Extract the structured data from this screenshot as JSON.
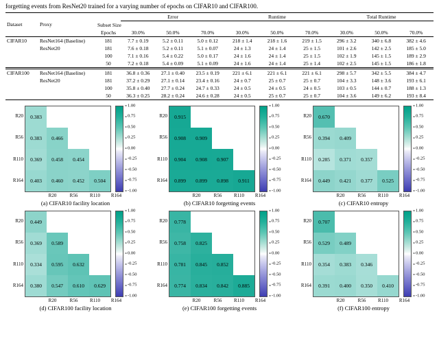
{
  "caption_top": "forgetting events from ResNet20 trained for a varying number of epochs on CIFAR10 and CIFAR100.",
  "table": {
    "col_groups": [
      {
        "title": "Error",
        "sizes": [
          "30.0%",
          "50.0%",
          "70.0%"
        ]
      },
      {
        "title": "Runtime",
        "sizes": [
          "30.0%",
          "50.0%",
          "70.0%"
        ]
      },
      {
        "title": "Total Runtime",
        "sizes": [
          "30.0%",
          "50.0%",
          "70.0%"
        ]
      }
    ],
    "head_left": {
      "dataset": "Dataset",
      "proxy": "Proxy",
      "epochs": "Epochs",
      "subset_size": "Subset Size"
    },
    "blocks": [
      {
        "dataset": "CIFAR10",
        "rows": [
          {
            "proxy": "ResNet164 (Baseline)",
            "epochs": "181",
            "error": [
              "7.7 ± 0.19",
              "5.2 ± 0.11",
              "5.0 ± 0.12"
            ],
            "runtime": [
              "218 ± 1.4",
              "218 ± 1.6",
              "219 ± 1.5"
            ],
            "total": [
              "296 ± 3.2",
              "340 ± 6.8",
              "382 ± 4.6"
            ]
          },
          {
            "proxy": "ResNet20",
            "epochs": "181",
            "error": [
              "7.6 ± 0.18",
              "5.2 ± 0.11",
              "5.1 ± 0.07"
            ],
            "runtime": [
              "24 ± 1.3",
              "24 ± 1.4",
              "25 ± 1.5"
            ],
            "total": [
              "101 ± 2.6",
              "142 ± 2.5",
              "185 ± 5.0"
            ]
          },
          {
            "proxy": "",
            "epochs": "100",
            "error": [
              "7.1 ± 0.16",
              "5.4 ± 0.22",
              "5.0 ± 0.17"
            ],
            "runtime": [
              "24 ± 1.6",
              "24 ± 1.4",
              "25 ± 1.5"
            ],
            "total": [
              "102 ± 1.9",
              "145 ± 1.5",
              "189 ± 2.9"
            ]
          },
          {
            "proxy": "",
            "epochs": "50",
            "error": [
              "7.2 ± 0.18",
              "5.4 ± 0.09",
              "5.1 ± 0.09"
            ],
            "runtime": [
              "24 ± 1.6",
              "24 ± 1.4",
              "25 ± 1.4"
            ],
            "total": [
              "102 ± 2.5",
              "145 ± 1.5",
              "186 ± 1.8"
            ]
          }
        ]
      },
      {
        "dataset": "CIFAR100",
        "rows": [
          {
            "proxy": "ResNet164 (Baseline)",
            "epochs": "181",
            "error": [
              "36.8 ± 0.36",
              "27.1 ± 0.40",
              "23.5 ± 0.19"
            ],
            "runtime": [
              "221 ± 6.1",
              "221 ± 6.1",
              "221 ± 6.1"
            ],
            "total": [
              "298 ± 5.7",
              "342 ± 5.5",
              "384 ± 4.7"
            ]
          },
          {
            "proxy": "ResNet20",
            "epochs": "181",
            "error": [
              "37.2 ± 0.29",
              "27.1 ± 0.14",
              "23.4 ± 0.16"
            ],
            "runtime": [
              "24 ± 0.7",
              "25 ± 0.7",
              "25 ± 0.7"
            ],
            "total": [
              "104 ± 3.3",
              "148 ± 3.6",
              "193 ± 6.1"
            ]
          },
          {
            "proxy": "",
            "epochs": "100",
            "error": [
              "35.8 ± 0.40",
              "27.7 ± 0.24",
              "24.7 ± 0.33"
            ],
            "runtime": [
              "24 ± 0.5",
              "24 ± 0.5",
              "24 ± 0.5"
            ],
            "total": [
              "103 ± 0.5",
              "144 ± 0.7",
              "188 ± 1.3"
            ]
          },
          {
            "proxy": "",
            "epochs": "50",
            "error": [
              "36.3 ± 0.25",
              "28.2 ± 0.24",
              "24.6 ± 0.28"
            ],
            "runtime": [
              "24 ± 0.5",
              "25 ± 0.7",
              "25 ± 0.7"
            ],
            "total": [
              "104 ± 3.6",
              "149 ± 6.2",
              "193 ± 8.4"
            ]
          }
        ]
      }
    ]
  },
  "colorbar_ticks": [
    "1.00",
    "0.75",
    "0.50",
    "0.25",
    "0.00",
    "-0.25",
    "-0.50",
    "-0.75",
    "-1.00"
  ],
  "axis_labels": [
    "R20",
    "R56",
    "R110",
    "R164"
  ],
  "heatmaps": [
    {
      "id": "a",
      "caption": "(a) CIFAR10 facility location",
      "cells": [
        [
          0.383,
          null,
          null,
          null
        ],
        [
          0.383,
          0.466,
          null,
          null
        ],
        [
          0.369,
          0.458,
          0.454,
          null
        ],
        [
          0.403,
          0.46,
          0.452,
          0.504
        ]
      ]
    },
    {
      "id": "b",
      "caption": "(b) CIFAR10 forgetting events",
      "cells": [
        [
          0.915,
          null,
          null,
          null
        ],
        [
          0.908,
          0.909,
          null,
          null
        ],
        [
          0.904,
          0.908,
          0.907,
          null
        ],
        [
          0.899,
          0.899,
          0.898,
          0.911
        ]
      ]
    },
    {
      "id": "c",
      "caption": "(c) CIFAR10 entropy",
      "cells": [
        [
          0.67,
          null,
          null,
          null
        ],
        [
          0.394,
          0.409,
          null,
          null
        ],
        [
          0.285,
          0.371,
          0.357,
          null
        ],
        [
          0.449,
          0.421,
          0.377,
          0.525
        ]
      ]
    },
    {
      "id": "d",
      "caption": "(d) CIFAR100 facility location",
      "cells": [
        [
          0.449,
          null,
          null,
          null
        ],
        [
          0.369,
          0.589,
          null,
          null
        ],
        [
          0.334,
          0.595,
          0.632,
          null
        ],
        [
          0.38,
          0.547,
          0.61,
          0.629
        ]
      ]
    },
    {
      "id": "e",
      "caption": "(e) CIFAR100 forgetting events",
      "cells": [
        [
          0.778,
          null,
          null,
          null
        ],
        [
          0.758,
          0.825,
          null,
          null
        ],
        [
          0.781,
          0.845,
          0.852,
          null
        ],
        [
          0.774,
          0.834,
          0.842,
          0.885
        ]
      ]
    },
    {
      "id": "f",
      "caption": "(f) CIFAR100 entropy",
      "cells": [
        [
          0.707,
          null,
          null,
          null
        ],
        [
          0.529,
          0.489,
          null,
          null
        ],
        [
          0.354,
          0.383,
          0.346,
          null
        ],
        [
          0.391,
          0.4,
          0.35,
          0.41
        ]
      ]
    }
  ],
  "chart_data": {
    "type": "heatmap",
    "shared": {
      "x_labels": [
        "R20",
        "R56",
        "R110",
        "R164"
      ],
      "y_labels": [
        "R20",
        "R56",
        "R110",
        "R164"
      ],
      "value_range": [
        -1.0,
        1.0
      ],
      "colormap": "teal-white-blue diverging",
      "upper_triangle_masked": true,
      "colorbar_ticks": [
        1.0,
        0.75,
        0.5,
        0.25,
        0.0,
        -0.25,
        -0.5,
        -0.75,
        -1.0
      ]
    },
    "panels": [
      {
        "name": "(a) CIFAR10 facility location",
        "matrix": [
          [
            0.383,
            null,
            null,
            null
          ],
          [
            0.383,
            0.466,
            null,
            null
          ],
          [
            0.369,
            0.458,
            0.454,
            null
          ],
          [
            0.403,
            0.46,
            0.452,
            0.504
          ]
        ]
      },
      {
        "name": "(b) CIFAR10 forgetting events",
        "matrix": [
          [
            0.915,
            null,
            null,
            null
          ],
          [
            0.908,
            0.909,
            null,
            null
          ],
          [
            0.904,
            0.908,
            0.907,
            null
          ],
          [
            0.899,
            0.899,
            0.898,
            0.911
          ]
        ]
      },
      {
        "name": "(c) CIFAR10 entropy",
        "matrix": [
          [
            0.67,
            null,
            null,
            null
          ],
          [
            0.394,
            0.409,
            null,
            null
          ],
          [
            0.285,
            0.371,
            0.357,
            null
          ],
          [
            0.449,
            0.421,
            0.377,
            0.525
          ]
        ]
      },
      {
        "name": "(d) CIFAR100 facility location",
        "matrix": [
          [
            0.449,
            null,
            null,
            null
          ],
          [
            0.369,
            0.589,
            null,
            null
          ],
          [
            0.334,
            0.595,
            0.632,
            null
          ],
          [
            0.38,
            0.547,
            0.61,
            0.629
          ]
        ]
      },
      {
        "name": "(e) CIFAR100 forgetting events",
        "matrix": [
          [
            0.778,
            null,
            null,
            null
          ],
          [
            0.758,
            0.825,
            null,
            null
          ],
          [
            0.781,
            0.845,
            0.852,
            null
          ],
          [
            0.774,
            0.834,
            0.842,
            0.885
          ]
        ]
      },
      {
        "name": "(f) CIFAR100 entropy",
        "matrix": [
          [
            0.707,
            null,
            null,
            null
          ],
          [
            0.529,
            0.489,
            null,
            null
          ],
          [
            0.354,
            0.383,
            0.346,
            null
          ],
          [
            0.391,
            0.4,
            0.35,
            0.41
          ]
        ]
      }
    ]
  }
}
